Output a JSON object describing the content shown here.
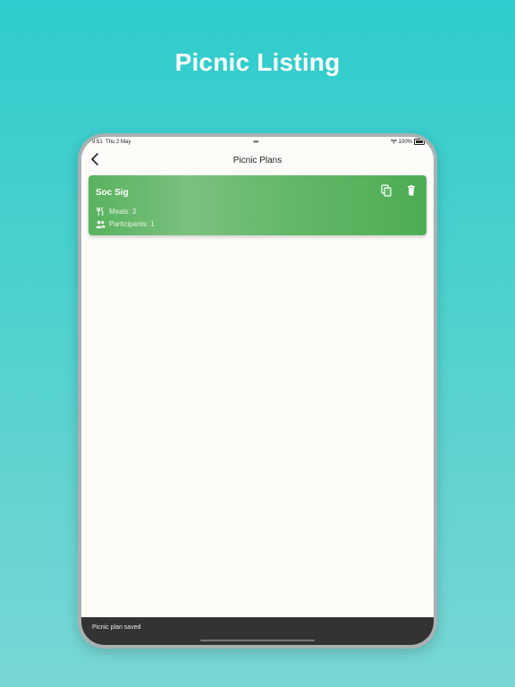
{
  "promo": {
    "title": "Picnic Listing"
  },
  "status_bar": {
    "time": "9:51",
    "date": "Thu 2 May",
    "battery": "100%"
  },
  "nav": {
    "title": "Picnic Plans",
    "back_icon": "chevron-left-icon"
  },
  "plans": [
    {
      "name": "Soc Sig",
      "meals": "Meals: 3",
      "participants": "Participants: 1"
    }
  ],
  "snackbar": {
    "message": "Picnic plan saved"
  },
  "colors": {
    "background": "#2ecccc",
    "card": "#5cb660",
    "snackbar": "#333333"
  }
}
